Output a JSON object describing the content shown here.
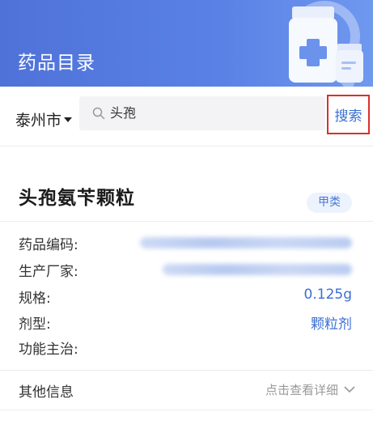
{
  "header": {
    "title": "药品目录",
    "illustration_icon": "medicine-bottle-search-icon"
  },
  "search": {
    "city": "泰州市",
    "query": "头孢",
    "button_label": "搜索",
    "button_highlight_color": "#d9302c"
  },
  "result": {
    "name": "头孢氨苄颗粒",
    "category_badge": "甲类",
    "fields": [
      {
        "label": "药品编码:",
        "value": ""
      },
      {
        "label": "生产厂家:",
        "value": ""
      },
      {
        "label": "规格:",
        "value": "0.125g"
      },
      {
        "label": "剂型:",
        "value": "颗粒剂"
      },
      {
        "label": "功能主治:",
        "value": ""
      }
    ]
  },
  "more_info": {
    "label": "其他信息",
    "link_text": "点击查看详细"
  },
  "colors": {
    "header_bg": "#5a82e6",
    "accent_blue": "#3b6fd4",
    "badge_bg": "#edf3fd"
  }
}
